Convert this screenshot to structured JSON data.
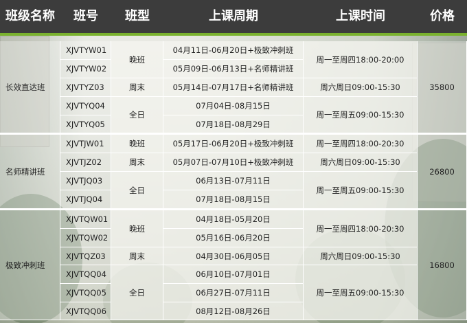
{
  "header": {
    "col_name": "班级名称",
    "col_code": "班号",
    "col_type": "班型",
    "col_period": "上课周期",
    "col_time": "上课时间",
    "col_price": "价格"
  },
  "groups": [
    {
      "name": "长效直达班",
      "price": "35800",
      "rows": [
        {
          "code": "XJVTYW01",
          "period": "04月11日-06月20日+极致冲刺班"
        },
        {
          "code": "XJVTYW02",
          "period": "05月09日-06月13日+名师精讲班"
        },
        {
          "code": "XJVTYZ03",
          "period": "05月14日-07月17日+名师精讲班"
        },
        {
          "code": "XJVTYQ04",
          "period": "07月04日-08月15日"
        },
        {
          "code": "XJVTYQ05",
          "period": "07月18日-08月29日"
        }
      ],
      "types": [
        "晚班",
        "周末",
        "全日"
      ],
      "times": [
        "周一至周四18:00-20:00",
        "周六周日09:00-15:30",
        "周一至周五09:00-15:30"
      ]
    },
    {
      "name": "名师精讲班",
      "price": "26800",
      "rows": [
        {
          "code": "XJVTJW01",
          "period": "05月17日-06月20日+极致冲刺班"
        },
        {
          "code": "XJVTJZ02",
          "period": "05月07日-07月10日+极致冲刺班"
        },
        {
          "code": "XJVTJQ03",
          "period": "06月13日-07月11日"
        },
        {
          "code": "XJVTJQ04",
          "period": "07月18日-08月15日"
        }
      ],
      "types": [
        "晚班",
        "周末",
        "全日"
      ],
      "times": [
        "周一至周四18:00-20:30",
        "周六周日09:00-15:30",
        "周一至周五09:00-15:30"
      ]
    },
    {
      "name": "极致冲刺班",
      "price": "16800",
      "rows": [
        {
          "code": "XJVTQW01",
          "period": "04月18日-05月20日"
        },
        {
          "code": "XJVTQW02",
          "period": "05月16日-06月20日"
        },
        {
          "code": "XJVTQZ03",
          "period": "04月30日-06月05日"
        },
        {
          "code": "XJVTQQ04",
          "period": "06月10日-07月01日"
        },
        {
          "code": "XJVTQQ05",
          "period": "06月27日-07月11日"
        },
        {
          "code": "XJVTQQ06",
          "period": "08月12日-08月26日"
        }
      ],
      "types": [
        "晚班",
        "周末",
        "全日"
      ],
      "times": [
        "周一至周四18:00-20:30",
        "周六周日09:00-15:30",
        "周一至周五09:00-15:30"
      ]
    }
  ],
  "colors": {
    "header_bg": "#3c3c3c",
    "header_accent": "#7ab22e",
    "grid_line": "#ffffff",
    "text": "#222222"
  }
}
